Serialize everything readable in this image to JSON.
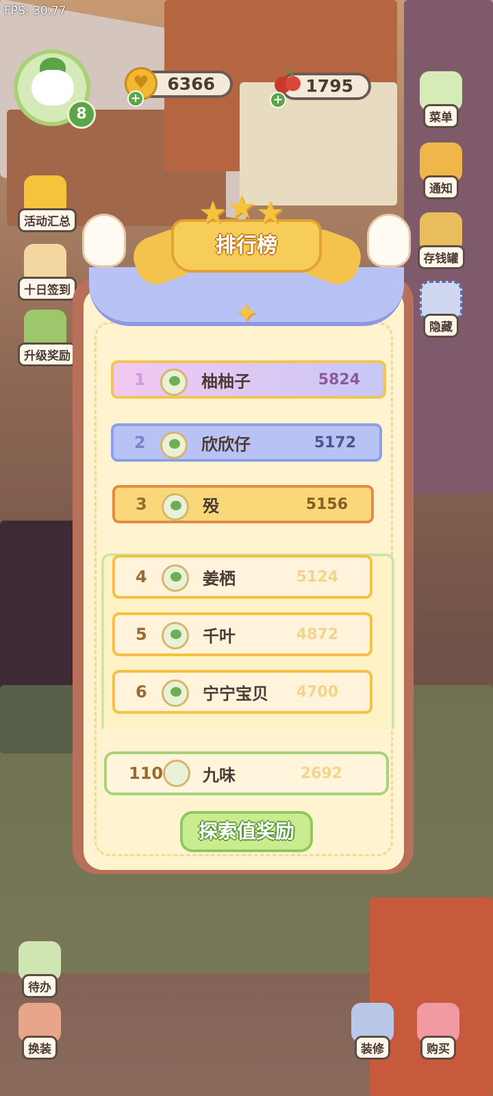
{
  "hud": {
    "fps": "FPS: 30.77",
    "level": "8",
    "coins": "6366",
    "cherries": "1795"
  },
  "left_menu": [
    {
      "label": "活动汇总",
      "icon": "crown-icon"
    },
    {
      "label": "十日签到",
      "icon": "calendar-icon"
    },
    {
      "label": "升级奖励",
      "icon": "gift-box-icon"
    }
  ],
  "right_menu": [
    {
      "label": "菜单",
      "icon": "menu-list-icon"
    },
    {
      "label": "通知",
      "icon": "bell-icon"
    },
    {
      "label": "存钱罐",
      "icon": "piggy-bank-icon"
    },
    {
      "label": "隐藏",
      "icon": "hide-frame-icon"
    }
  ],
  "bottom_left": [
    {
      "label": "待办",
      "icon": "todo-clipboard-icon"
    },
    {
      "label": "换装",
      "icon": "dress-up-icon"
    }
  ],
  "bottom_right": [
    {
      "label": "装修",
      "icon": "renovate-icon"
    },
    {
      "label": "购买",
      "icon": "shopping-bag-icon"
    }
  ],
  "leaderboard": {
    "title": "排行榜",
    "top": [
      {
        "rank": "1",
        "name": "柚柚子",
        "score": "5824",
        "style": "pink"
      },
      {
        "rank": "2",
        "name": "欣欣仔",
        "score": "5172",
        "style": "blue"
      },
      {
        "rank": "3",
        "name": "殁",
        "score": "5156",
        "style": "gold"
      }
    ],
    "rest": [
      {
        "rank": "4",
        "name": "姜栖",
        "score": "5124"
      },
      {
        "rank": "5",
        "name": "千叶",
        "score": "4872"
      },
      {
        "rank": "6",
        "name": "宁宁宝贝",
        "score": "4700"
      }
    ],
    "me": {
      "rank": "110",
      "name": "九味",
      "score": "2692"
    },
    "reward_button": "探索值奖励"
  },
  "colors": {
    "pink_row": "#f2c8ef",
    "blue_row": "#b9c2f4",
    "gold_row": "#f8d879",
    "normal_row": "#fff3dc",
    "green_button": "#c8ec8e"
  }
}
